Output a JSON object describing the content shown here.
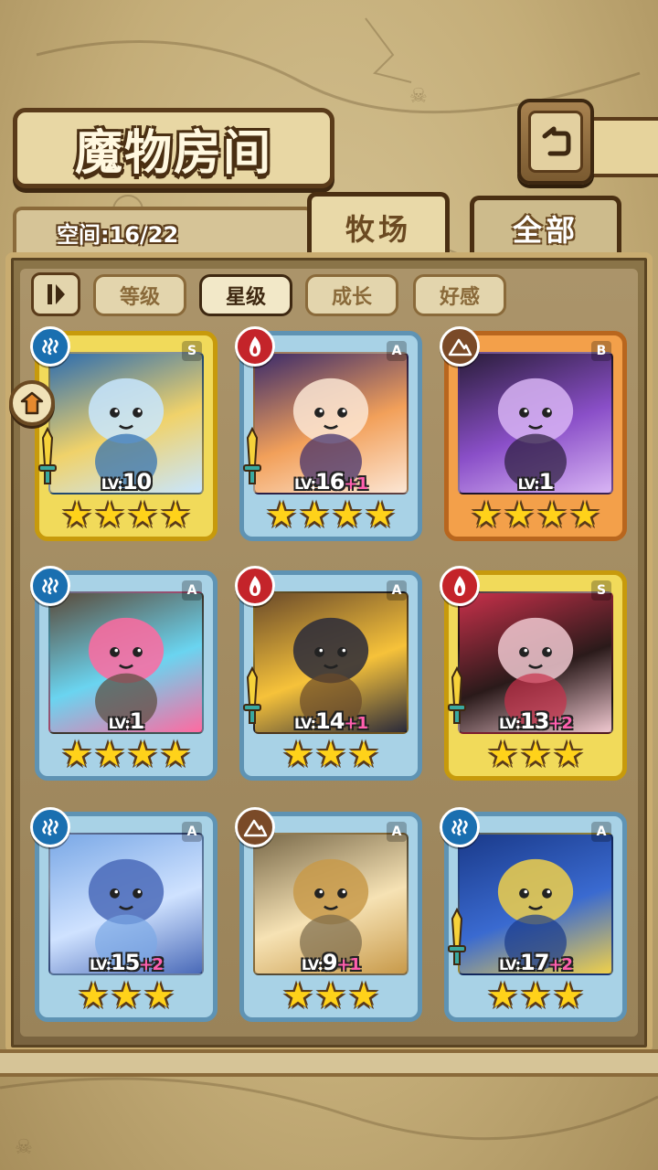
{
  "header": {
    "title": "魔物房间",
    "back_icon": "return-arrow-icon"
  },
  "storage": {
    "space_label": "空间:16/22"
  },
  "tabs": [
    {
      "label": "牧场",
      "active": true
    },
    {
      "label": "全部",
      "active": false
    }
  ],
  "sort_filters": [
    {
      "label": "等级",
      "active": false
    },
    {
      "label": "星级",
      "active": true
    },
    {
      "label": "成长",
      "active": false
    },
    {
      "label": "好感",
      "active": false
    }
  ],
  "monsters": [
    {
      "element": "water",
      "rank": "S",
      "frame": "gold",
      "lv": "10",
      "bonus": "",
      "stars": 4,
      "weapon": true,
      "palette": [
        "#2b6cb0",
        "#f0d26a",
        "#c8e6ff"
      ]
    },
    {
      "element": "fire",
      "rank": "A",
      "frame": "blue",
      "lv": "16",
      "bonus": "+1",
      "stars": 4,
      "weapon": true,
      "palette": [
        "#3a2a6a",
        "#f2a05a",
        "#fce6d4"
      ]
    },
    {
      "element": "earth",
      "rank": "B",
      "frame": "orange",
      "lv": "1",
      "bonus": "",
      "stars": 4,
      "weapon": false,
      "palette": [
        "#2a1d3a",
        "#8a4fc8",
        "#d8b4f4"
      ]
    },
    {
      "element": "water",
      "rank": "A",
      "frame": "blue",
      "lv": "1",
      "bonus": "",
      "stars": 4,
      "weapon": false,
      "palette": [
        "#5a4a3a",
        "#6ad4f0",
        "#ff6aa0"
      ]
    },
    {
      "element": "fire",
      "rank": "A",
      "frame": "blue",
      "lv": "14",
      "bonus": "+1",
      "stars": 3,
      "weapon": true,
      "palette": [
        "#6a4a2a",
        "#f6c23a",
        "#2a2a3a"
      ]
    },
    {
      "element": "fire",
      "rank": "S",
      "frame": "gold",
      "lv": "13",
      "bonus": "+2",
      "stars": 3,
      "weapon": true,
      "palette": [
        "#c8304a",
        "#2a1a1a",
        "#f0c8d0"
      ]
    },
    {
      "element": "water",
      "rank": "A",
      "frame": "blue",
      "lv": "15",
      "bonus": "+2",
      "stars": 3,
      "weapon": false,
      "palette": [
        "#7aa8e6",
        "#cfe2ff",
        "#4a6ab8"
      ]
    },
    {
      "element": "earth",
      "rank": "A",
      "frame": "blue",
      "lv": "9",
      "bonus": "+1",
      "stars": 3,
      "weapon": false,
      "palette": [
        "#7a6a4a",
        "#f6e2b4",
        "#c89a4a"
      ]
    },
    {
      "element": "water",
      "rank": "A",
      "frame": "blue",
      "lv": "17",
      "bonus": "+2",
      "stars": 3,
      "weapon": true,
      "palette": [
        "#1a3a8a",
        "#3a6ad0",
        "#f0d04a"
      ]
    }
  ],
  "lock_icon": "team-lock-icon"
}
